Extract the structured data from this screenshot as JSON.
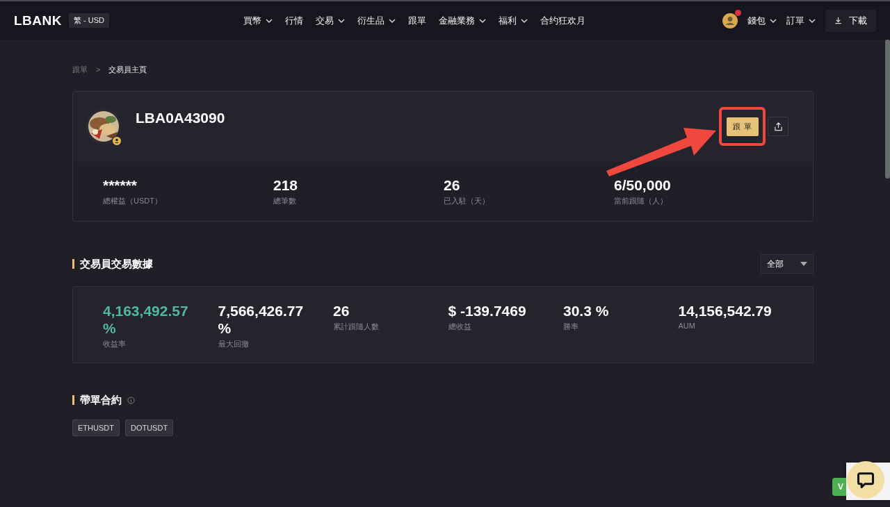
{
  "header": {
    "logo": "LBANK",
    "locale": "繁 - USD",
    "nav": [
      {
        "label": "買幣",
        "dropdown": true
      },
      {
        "label": "行情",
        "dropdown": false
      },
      {
        "label": "交易",
        "dropdown": true
      },
      {
        "label": "衍生品",
        "dropdown": true
      },
      {
        "label": "跟單",
        "dropdown": false
      },
      {
        "label": "金融業務",
        "dropdown": true
      },
      {
        "label": "福利",
        "dropdown": true
      },
      {
        "label": "合约狂欢月",
        "dropdown": false
      }
    ],
    "notification": true,
    "menus": [
      {
        "label": "錢包"
      },
      {
        "label": "訂單"
      }
    ],
    "download": "下載"
  },
  "breadcrumb": [
    {
      "label": "跟單",
      "current": false
    },
    {
      "label": "交易員主頁",
      "current": true
    }
  ],
  "breadcrumb_separator": ">",
  "profile": {
    "name": "LBA0A43090",
    "follow_button": "跟 單",
    "stats": [
      {
        "value": "******",
        "label": "總權益（USDT）"
      },
      {
        "value": "218",
        "label": "總筆數"
      },
      {
        "value": "26",
        "label": "已入駐（天）"
      },
      {
        "value": "6/50,000",
        "label": "當前跟隨（人）"
      }
    ]
  },
  "trading_data": {
    "title": "交易員交易數據",
    "filter": "全部",
    "stats": [
      {
        "value": "4,163,492.57 %",
        "label": "收益率",
        "color": "#4fb99f"
      },
      {
        "value": "7,566,426.77 %",
        "label": "最大回撤",
        "color": "#ffffff"
      },
      {
        "value": "26",
        "label": "累計跟隨人數",
        "color": "#ffffff"
      },
      {
        "value": "$ -139.7469",
        "label": "總收益",
        "color": "#ffffff"
      },
      {
        "value": "30.3 %",
        "label": "勝率",
        "color": "#ffffff"
      },
      {
        "value": "14,156,542.79",
        "label": "AUM",
        "color": "#ffffff"
      }
    ]
  },
  "contracts": {
    "title": "帶單合約",
    "tags": [
      "ETHUSDT",
      "DOTUSDT"
    ]
  },
  "widget": {
    "button": "V"
  }
}
